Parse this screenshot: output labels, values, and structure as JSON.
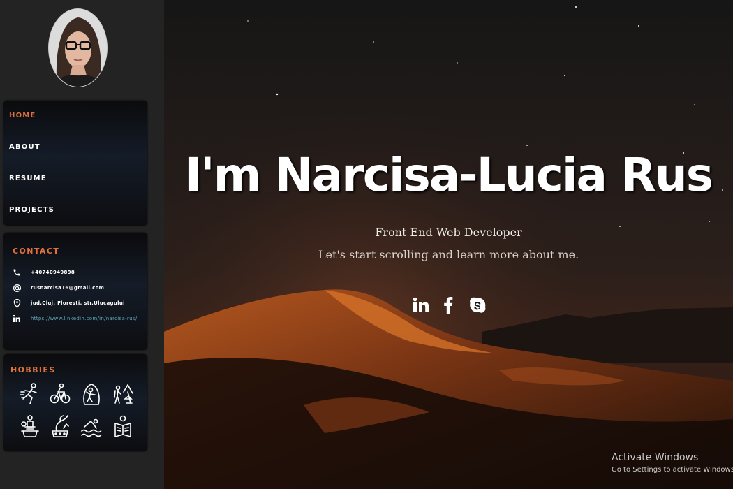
{
  "sidebar": {
    "avatar_alt": "profile photo",
    "nav": [
      {
        "label": "HOME",
        "active": true
      },
      {
        "label": "ABOUT",
        "active": false
      },
      {
        "label": "RESUME",
        "active": false
      },
      {
        "label": "PROJECTS",
        "active": false
      }
    ],
    "contact": {
      "title": "CONTACT",
      "phone": "+40740949898",
      "email": "rusnarcisa16@gmail.com",
      "address": "jud.Cluj, Floresti, str.Ulucagului",
      "linkedin": "https://www.linkedin.com/in/narcisa-rus/"
    },
    "hobbies": {
      "title": "HOBBIES",
      "icons": [
        "running-icon",
        "cycling-icon",
        "climbing-icon",
        "hiking-icon",
        "cooking-icon",
        "gardening-icon",
        "swimming-icon",
        "reading-icon"
      ]
    }
  },
  "hero": {
    "title": "I'm Narcisa-Lucia Rus",
    "role": "Front End Web Developer",
    "tagline": "Let's start scrolling and learn more about me.",
    "socials": [
      "linkedin-icon",
      "facebook-icon",
      "skype-icon"
    ]
  },
  "os_overlay": {
    "line1": "Activate Windows",
    "line2": "Go to Settings to activate Windows."
  },
  "colors": {
    "accent": "#e0713c",
    "link": "#5fa6b6",
    "sidebar_bg": "#232323"
  }
}
